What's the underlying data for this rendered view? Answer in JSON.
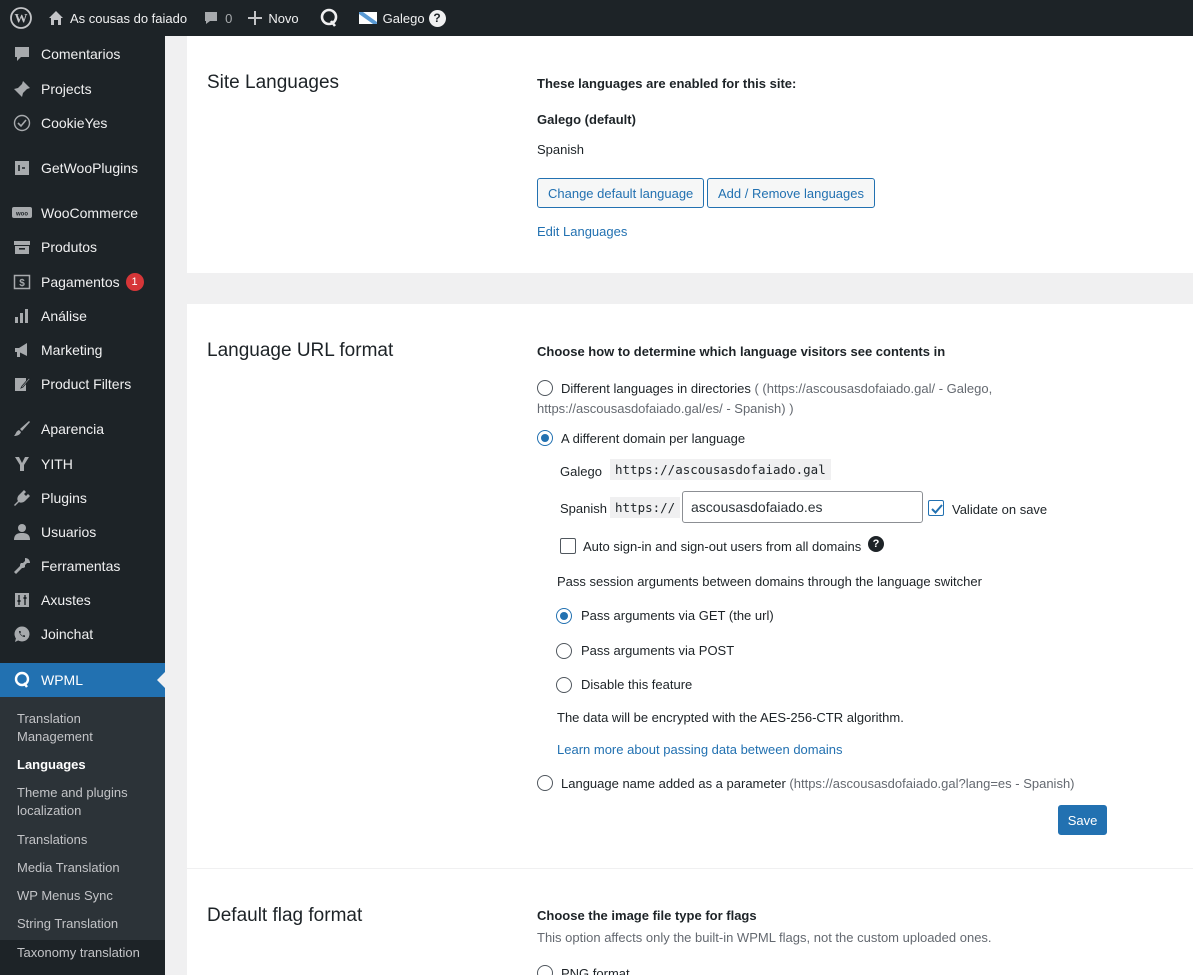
{
  "adminbar": {
    "site_name": "As cousas do faiado",
    "comments_count": "0",
    "new_label": "Novo",
    "language_label": "Galego",
    "help_label": "?"
  },
  "sidebar": {
    "items": [
      {
        "label": "Comentarios",
        "icon": "comment-icon"
      },
      {
        "label": "Projects",
        "icon": "pin-icon"
      },
      {
        "label": "CookieYes",
        "icon": "cookie-icon"
      },
      {
        "label": "GetWooPlugins",
        "icon": "plugin-box-icon"
      },
      {
        "label": "WooCommerce",
        "icon": "woo-icon"
      },
      {
        "label": "Produtos",
        "icon": "archive-icon"
      },
      {
        "label": "Pagamentos",
        "icon": "dollar-icon",
        "badge": "1"
      },
      {
        "label": "Análise",
        "icon": "bar-chart-icon"
      },
      {
        "label": "Marketing",
        "icon": "megaphone-icon"
      },
      {
        "label": "Product Filters",
        "icon": "edit-icon"
      },
      {
        "label": "Aparencia",
        "icon": "brush-icon"
      },
      {
        "label": "YITH",
        "icon": "yith-icon"
      },
      {
        "label": "Plugins",
        "icon": "plug-icon"
      },
      {
        "label": "Usuarios",
        "icon": "user-icon"
      },
      {
        "label": "Ferramentas",
        "icon": "wrench-icon"
      },
      {
        "label": "Axustes",
        "icon": "settings-icon"
      },
      {
        "label": "Joinchat",
        "icon": "whatsapp-icon"
      },
      {
        "label": "WPML",
        "icon": "wpml-icon"
      }
    ],
    "submenu": [
      "Translation Management",
      "Languages",
      "Theme and plugins localization",
      "Translations",
      "Media Translation",
      "WP Menus Sync",
      "String Translation",
      "Taxonomy translation"
    ]
  },
  "site_languages": {
    "title": "Site Languages",
    "intro": "These languages are enabled for this site:",
    "default_language": "Galego (default)",
    "other_language": "Spanish",
    "change_default_btn": "Change default language",
    "add_remove_btn": "Add / Remove languages",
    "edit_link": "Edit Languages"
  },
  "url_format": {
    "title": "Language URL format",
    "intro": "Choose how to determine which language visitors see contents in",
    "opt_directories_label": "Different languages in directories",
    "opt_directories_hint_1": "( (https://ascousasdofaiado.gal/ - Galego,",
    "opt_directories_hint_2": "https://ascousasdofaiado.gal/es/ - Spanish) )",
    "opt_domain_label": "A different domain per language",
    "galego_label": "Galego",
    "galego_url": "https://ascousasdofaiado.gal",
    "spanish_label": "Spanish",
    "spanish_prefix": "https://",
    "spanish_domain": "ascousasdofaiado.es",
    "validate_label": "Validate on save",
    "autosignin_label": "Auto sign-in and sign-out users from all domains",
    "pass_session_text": "Pass session arguments between domains through the language switcher",
    "pass_get_label": "Pass arguments via GET (the url)",
    "pass_post_label": "Pass arguments via POST",
    "disable_label": "Disable this feature",
    "encrypt_text": "The data will be encrypted with the AES-256-CTR algorithm.",
    "learn_more_link": "Learn more about passing data between domains",
    "opt_param_label": "Language name added as a parameter",
    "opt_param_hint": "(https://ascousasdofaiado.gal?lang=es - Spanish)",
    "save_btn": "Save"
  },
  "flag_format": {
    "title": "Default flag format",
    "intro": "Choose the image file type for flags",
    "note": "This option affects only the built-in WPML flags, not the custom uploaded ones.",
    "opt_png": "PNG format"
  },
  "colors": {
    "adminbar_bg": "#1d2327",
    "accent": "#2271b1",
    "badge": "#d63638"
  }
}
